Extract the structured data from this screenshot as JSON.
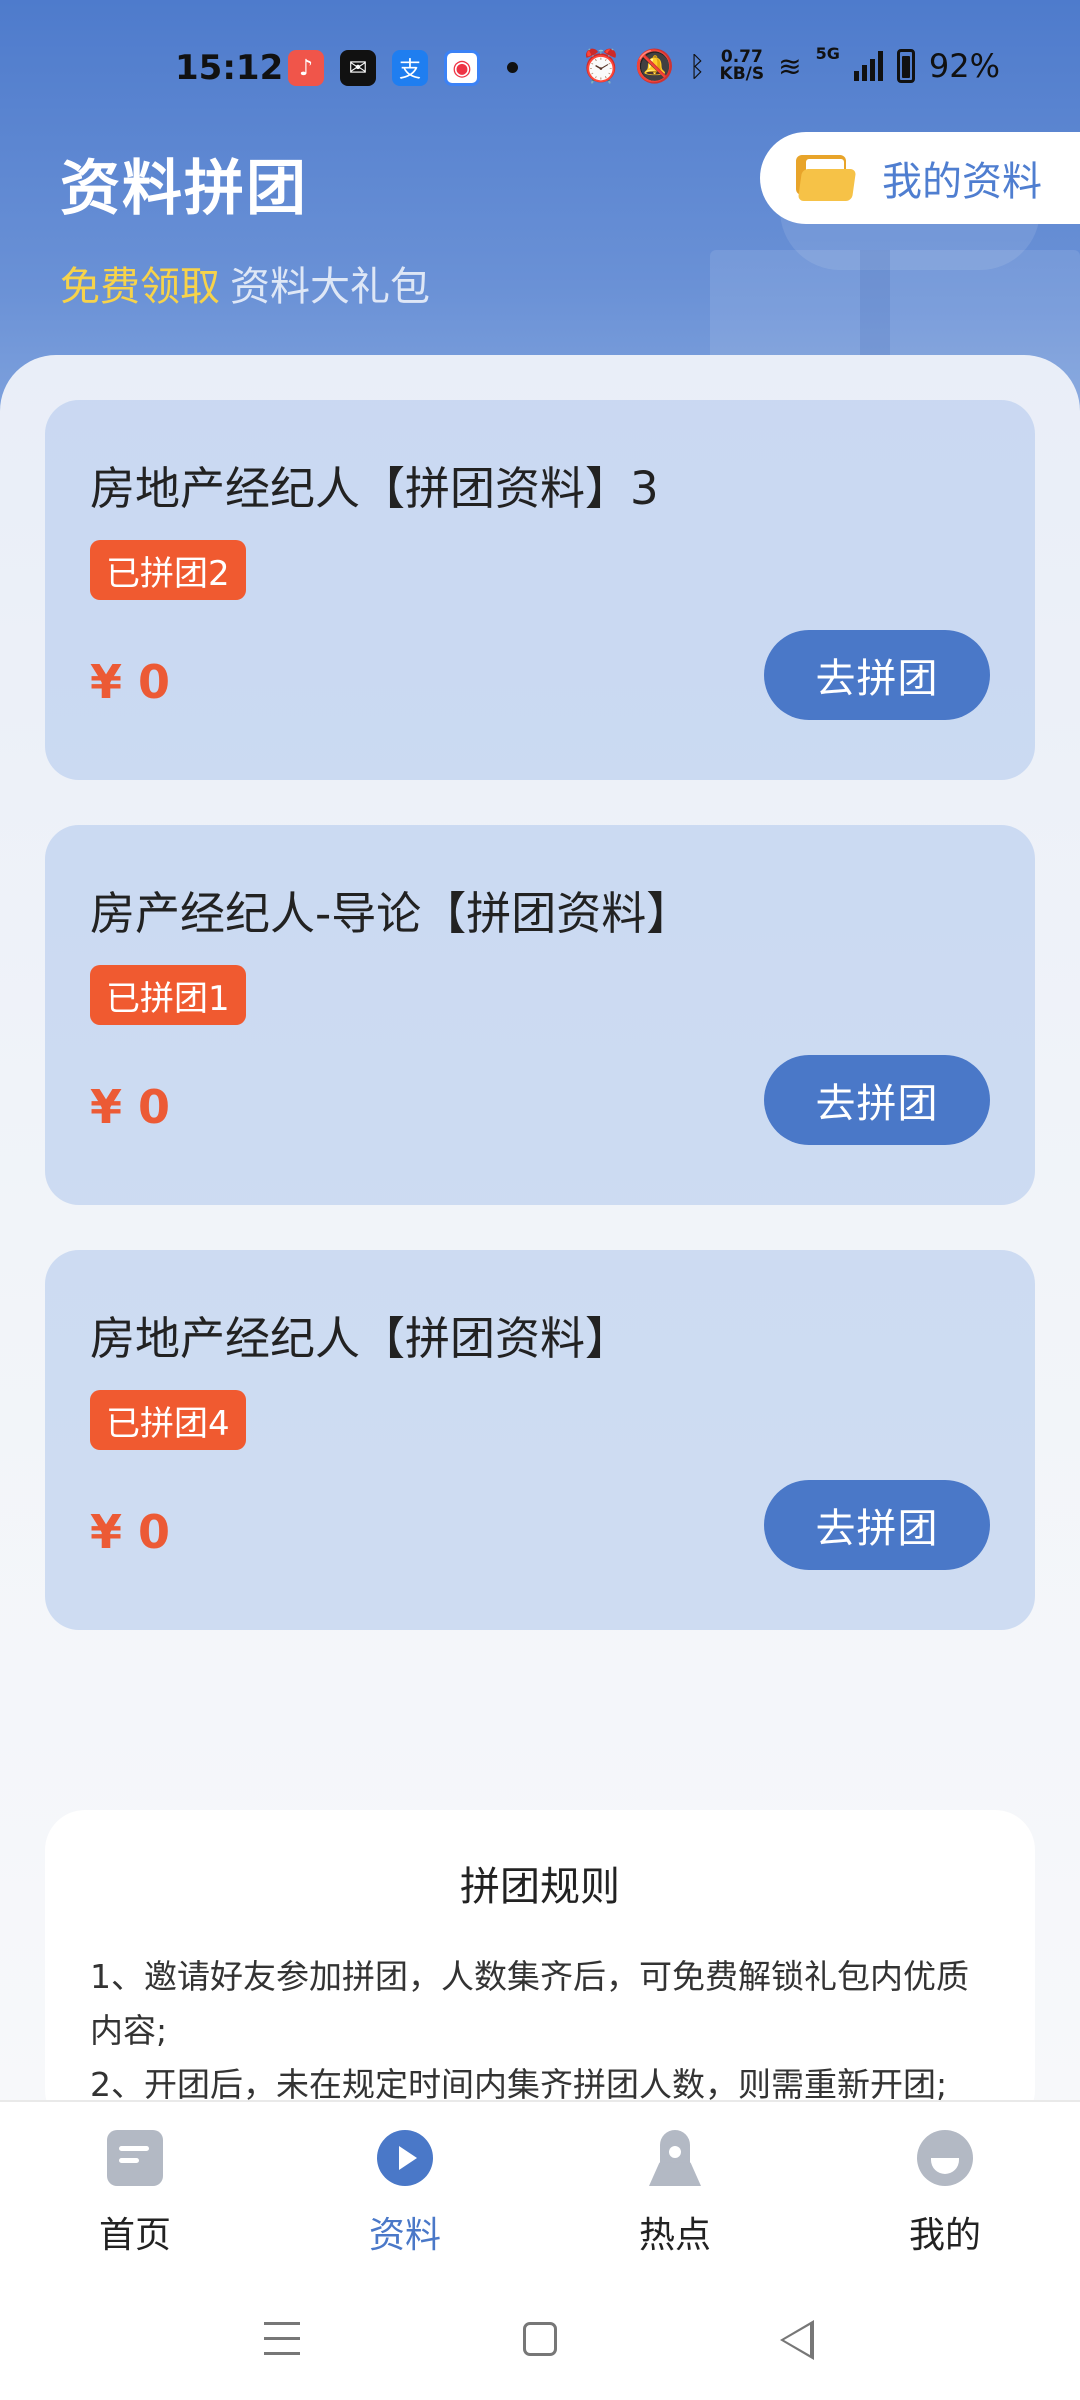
{
  "status_bar": {
    "time": "15:12",
    "net_speed_value": "0.77",
    "net_speed_unit": "KB/S",
    "net_type": "5G",
    "battery": "92%"
  },
  "header": {
    "title": "资料拼团",
    "subtitle_highlight": "免费领取",
    "subtitle_rest": "资料大礼包",
    "my_materials_label": "我的资料"
  },
  "cards": [
    {
      "title": "房地产经纪人【拼团资料】3",
      "badge": "已拼团2",
      "price": "¥ 0",
      "button": "去拼团"
    },
    {
      "title": "房产经纪人-导论【拼团资料】",
      "badge": "已拼团1",
      "price": "¥ 0",
      "button": "去拼团"
    },
    {
      "title": "房地产经纪人【拼团资料】",
      "badge": "已拼团4",
      "price": "¥ 0",
      "button": "去拼团"
    }
  ],
  "rules": {
    "title": "拼团规则",
    "items": [
      "1、邀请好友参加拼团，人数集齐后，可免费解锁礼包内优质内容;",
      "2、开团后，未在规定时间内集齐拼团人数，则需重新开团;"
    ]
  },
  "tabbar": {
    "tabs": [
      {
        "label": "首页",
        "icon": "document-icon"
      },
      {
        "label": "资料",
        "icon": "play-icon"
      },
      {
        "label": "热点",
        "icon": "rocket-icon"
      },
      {
        "label": "我的",
        "icon": "profile-icon"
      }
    ],
    "active_index": 1
  },
  "colors": {
    "primary": "#4a78c8",
    "badge": "#f05a30",
    "price": "#ec5a35",
    "highlight": "#f7d34a"
  }
}
